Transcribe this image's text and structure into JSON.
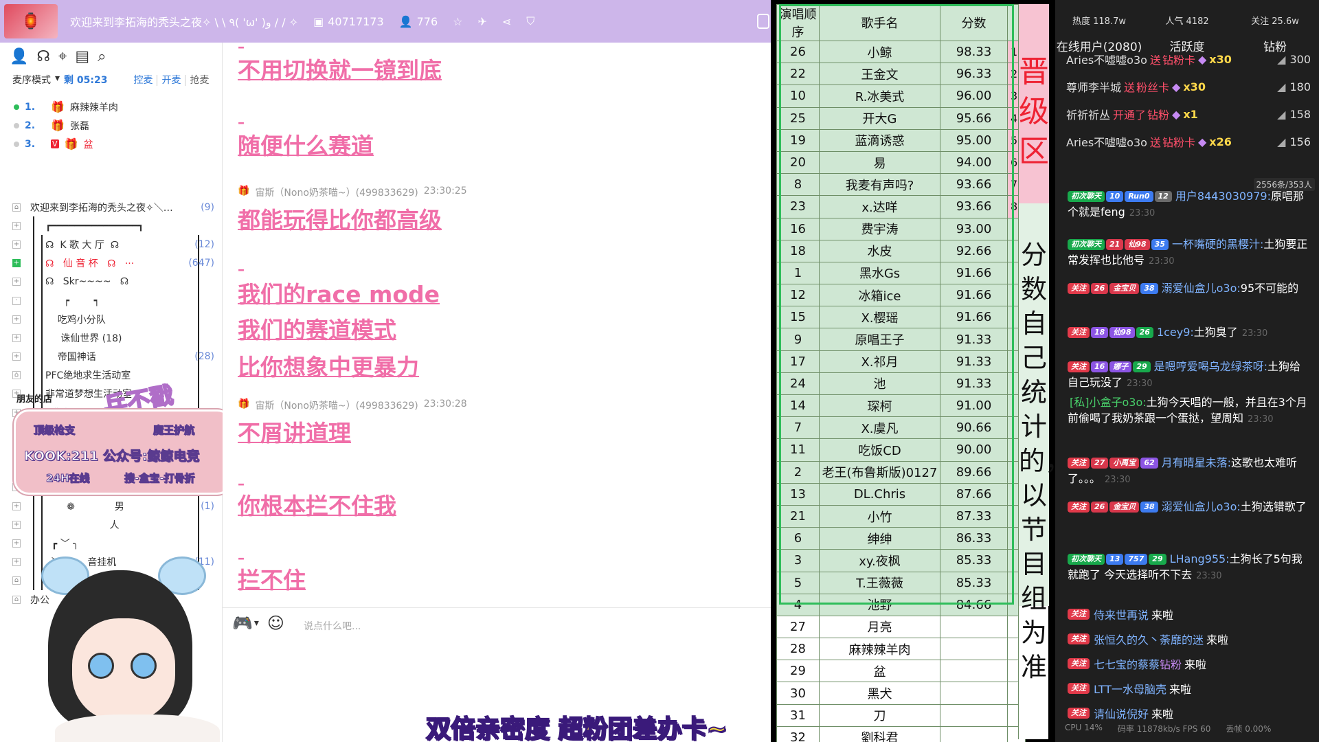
{
  "topbar": {
    "title": "欢迎来到李拓海的秃头之夜✧ \\ \\ ٩( 'ω' )و / / ✧",
    "id": "40717173",
    "online": "776"
  },
  "sidebar": {
    "mic_mode": "麦序模式",
    "remaining": "剩 05:23",
    "actions": [
      "控麦",
      "开麦",
      "抢麦"
    ],
    "queue": [
      {
        "num": "1.",
        "name": "麻辣辣羊肉",
        "red": false,
        "vip": false
      },
      {
        "num": "2.",
        "name": "张磊",
        "red": false,
        "vip": false
      },
      {
        "num": "3.",
        "name": "盆",
        "red": true,
        "vip": true
      }
    ],
    "channels": [
      {
        "label": "欢迎来到李拓海的秃头之夜✧＼…",
        "count": "(9)",
        "pm": "⌂",
        "red": false,
        "bars": 0
      },
      {
        "label": "┏━━━━━━━━━━━━━━━┓",
        "count": "",
        "pm": "+",
        "red": false,
        "bars": 1
      },
      {
        "label": "☊  K 歌 大 厅  ☊",
        "count": "(12)",
        "pm": "+",
        "red": false,
        "bars": 2
      },
      {
        "label": "☊   仙 音 杯   ☊   ···",
        "count": "(647)",
        "pm": "+",
        "red": true,
        "bars": 2
      },
      {
        "label": "☊   Skr~~~~   ☊",
        "count": "",
        "pm": "+",
        "red": false,
        "bars": 2
      },
      {
        "label": "      ┍        ┑",
        "count": "",
        "pm": "·",
        "red": false,
        "bars": 2
      },
      {
        "label": "    吃鸡小分队",
        "count": "",
        "pm": "+",
        "red": false,
        "bars": 2
      },
      {
        "label": "     诛仙世界 (18)",
        "count": "",
        "pm": "+",
        "red": false,
        "bars": 2
      },
      {
        "label": "    帝国神话",
        "count": "(28)",
        "pm": "+",
        "red": false,
        "bars": 2
      },
      {
        "label": "PFC绝地求生活动室",
        "count": "",
        "pm": "⌂",
        "red": false,
        "bars": 2
      },
      {
        "label": "非常道梦想生活动室",
        "count": "",
        "pm": "+",
        "red": false,
        "bars": 2
      },
      {
        "label": "  非常",
        "count": "",
        "pm": "+",
        "red": false,
        "bars": 2
      },
      {
        "label": "",
        "count": "",
        "pm": "+",
        "red": false,
        "bars": 2
      },
      {
        "label": "",
        "count": "",
        "pm": "+",
        "red": false,
        "bars": 2
      },
      {
        "label": "",
        "count": "",
        "pm": "+",
        "red": false,
        "bars": 2
      },
      {
        "label": "",
        "count": "",
        "pm": "+",
        "red": false,
        "bars": 2
      },
      {
        "label": "       ❁             男",
        "count": "(1)",
        "pm": "+",
        "red": false,
        "bars": 2
      },
      {
        "label": "                     人",
        "count": "",
        "pm": "+",
        "red": false,
        "bars": 2
      },
      {
        "label": "  ┏ ﹀ ╮",
        "count": "",
        "pm": "+",
        "red": false,
        "bars": 2
      },
      {
        "label": "  ﹀  ❁    音挂机",
        "count": "(11)",
        "pm": "+",
        "red": false,
        "bars": 2
      },
      {
        "label": "",
        "count": "",
        "pm": "⌂",
        "red": false,
        "bars": 2
      },
      {
        "label": "办公",
        "count": "",
        "pm": "⌂",
        "red": false,
        "bars": 0
      }
    ]
  },
  "ad": {
    "friend_shop": "朋友的店",
    "stamp": "兵不戳",
    "line1_left": "顶级枪支",
    "line1_right": "魔王护航",
    "line2": "KOOK:211  公众号:鲸鲸电竞",
    "line3_left": "24H在线",
    "line3_right": "搜-盒宝-打骨折"
  },
  "chat": {
    "items": [
      {
        "kind": "dash",
        "text": "–"
      },
      {
        "kind": "line",
        "text": "不用切换就一镜到底"
      },
      {
        "kind": "dash",
        "text": "–"
      },
      {
        "kind": "line",
        "text": "随便什么赛道"
      },
      {
        "kind": "head",
        "user": "宙斯（Nono奶茶喵~）(499833629)",
        "time": "23:30:25"
      },
      {
        "kind": "line",
        "text": "都能玩得比你都高级"
      },
      {
        "kind": "dash",
        "text": "–"
      },
      {
        "kind": "line",
        "text": "我们的race mode"
      },
      {
        "kind": "line",
        "text": "我们的赛道模式"
      },
      {
        "kind": "line",
        "text": "比你想象中更暴力"
      },
      {
        "kind": "head",
        "user": "宙斯（Nono奶茶喵~）(499833629)",
        "time": "23:30:28"
      },
      {
        "kind": "line",
        "text": "不屑讲道理"
      },
      {
        "kind": "dash",
        "text": "–"
      },
      {
        "kind": "line",
        "text": "你根本拦不住我"
      },
      {
        "kind": "dash",
        "text": "–"
      },
      {
        "kind": "line",
        "text": "拦不住"
      }
    ],
    "input_placeholder": "说点什么吧..."
  },
  "subtitle": "双倍亲密度 超粉团差办卡~",
  "score_table": {
    "headers": [
      "演唱顺序",
      "歌手名",
      "分数",
      ""
    ],
    "promo_label": "晋级区",
    "note_label": "分数自己统计的，以节目组为准",
    "rows": [
      {
        "order": "26",
        "name": "小鲸",
        "score": "98.33",
        "pos": "1"
      },
      {
        "order": "22",
        "name": "王金文",
        "score": "96.33",
        "pos": "2"
      },
      {
        "order": "10",
        "name": "R.冰美式",
        "score": "96.00",
        "pos": "3"
      },
      {
        "order": "25",
        "name": "开大G",
        "score": "95.66",
        "pos": "4"
      },
      {
        "order": "19",
        "name": "蓝滴诱惑",
        "score": "95.00",
        "pos": "5"
      },
      {
        "order": "20",
        "name": "易",
        "score": "94.00",
        "pos": "6"
      },
      {
        "order": "8",
        "name": "我麦有声吗?",
        "score": "93.66",
        "pos": "7"
      },
      {
        "order": "23",
        "name": "x.达咩",
        "score": "93.66",
        "pos": "8"
      },
      {
        "order": "16",
        "name": "费宇涛",
        "score": "93.00",
        "pos": ""
      },
      {
        "order": "18",
        "name": "水皮",
        "score": "92.66",
        "pos": ""
      },
      {
        "order": "1",
        "name": "黑水Gs",
        "score": "91.66",
        "pos": ""
      },
      {
        "order": "12",
        "name": "冰箱ice",
        "score": "91.66",
        "pos": ""
      },
      {
        "order": "15",
        "name": "X.樱瑶",
        "score": "91.66",
        "pos": ""
      },
      {
        "order": "9",
        "name": "原唱王子",
        "score": "91.33",
        "pos": ""
      },
      {
        "order": "17",
        "name": "X.祁月",
        "score": "91.33",
        "pos": ""
      },
      {
        "order": "24",
        "name": "池",
        "score": "91.33",
        "pos": ""
      },
      {
        "order": "14",
        "name": "琛柯",
        "score": "91.00",
        "pos": ""
      },
      {
        "order": "7",
        "name": "X.虞凡",
        "score": "90.66",
        "pos": ""
      },
      {
        "order": "11",
        "name": "吃饭CD",
        "score": "90.00",
        "pos": ""
      },
      {
        "order": "2",
        "name": "老王(布鲁斯版)0127",
        "score": "89.66",
        "pos": ""
      },
      {
        "order": "13",
        "name": "DL.Chris",
        "score": "87.66",
        "pos": ""
      },
      {
        "order": "21",
        "name": "小竹",
        "score": "87.33",
        "pos": ""
      },
      {
        "order": "6",
        "name": "绅绅",
        "score": "86.33",
        "pos": ""
      },
      {
        "order": "3",
        "name": "xy.夜枫",
        "score": "85.33",
        "pos": ""
      },
      {
        "order": "5",
        "name": "T.王薇薇",
        "score": "85.33",
        "pos": ""
      },
      {
        "order": "4",
        "name": "池野",
        "score": "84.66",
        "pos": ""
      }
    ],
    "rest": [
      {
        "order": "27",
        "name": "月亮"
      },
      {
        "order": "28",
        "name": "麻辣辣羊肉"
      },
      {
        "order": "29",
        "name": "盆"
      },
      {
        "order": "30",
        "name": "黑犬"
      },
      {
        "order": "31",
        "name": "刀"
      },
      {
        "order": "32",
        "name": "劉科君"
      }
    ]
  },
  "live": {
    "stats": [
      "热度 118.7w",
      "人气 4182",
      "关注 25.6w"
    ],
    "tabs": [
      "在线用户(2080)",
      "活跃度",
      "钻粉"
    ],
    "gifts": [
      {
        "user": "Aries不嘘嘘o3o",
        "act": "送",
        "item": "钻粉卡",
        "x": "x30",
        "score": "300"
      },
      {
        "user": "尊师李半城",
        "act": "送",
        "item": "粉丝卡",
        "x": "x30",
        "score": "180"
      },
      {
        "user": "祈祈祈丛",
        "act": "开通了",
        "item": "钻粉",
        "x": "x1",
        "score": "158"
      },
      {
        "user": "Aries不嘘嘘o3o",
        "act": "送",
        "item": "钻粉卡",
        "x": "x26",
        "score": "156"
      }
    ],
    "counter": "2556条/353人",
    "messages": [
      {
        "badges": [
          [
            "初次聊天",
            "b-green"
          ],
          [
            "10",
            "b-blue"
          ],
          [
            "Run0",
            "b-blue"
          ],
          [
            "12",
            "b-level"
          ]
        ],
        "nick": "用户8443030979:",
        "text": "原唱那个就是feng",
        "ts": "23:30"
      },
      {
        "badges": [
          [
            "初次聊天",
            "b-green"
          ],
          [
            "21",
            "b-vip"
          ],
          [
            "仙98",
            "b-vip"
          ],
          [
            "35",
            "b-blue"
          ]
        ],
        "nick": "一杯嘴硬的黑樱汁:",
        "text": "土狗要正常发挥也比他号",
        "ts": "23:30"
      },
      {
        "badges": [
          [
            "关注",
            "b-red"
          ],
          [
            "26",
            "b-vip"
          ],
          [
            "金宝贝",
            "b-vip"
          ],
          [
            "38",
            "b-blue"
          ]
        ],
        "nick": "溺爱仙盒儿o3o:",
        "text": "95不可能的",
        "ts": ""
      },
      {
        "badges": [
          [
            "关注",
            "b-red"
          ],
          [
            "18",
            "b-purple"
          ],
          [
            "仙98",
            "b-purple"
          ],
          [
            "26",
            "b-green"
          ]
        ],
        "nick": "1cey9:",
        "text": "土狗臭了",
        "ts": "23:30"
      },
      {
        "badges": [
          [
            "关注",
            "b-red"
          ],
          [
            "16",
            "b-purple"
          ],
          [
            "娜子",
            "b-purple"
          ],
          [
            "29",
            "b-green"
          ]
        ],
        "nick": "是嗯哼爱喝乌龙绿茶呀:",
        "text": "土狗给自己玩没了",
        "ts": "23:30"
      },
      {
        "badges": [],
        "nick": "[私]小盒子o3o:",
        "text": "土狗今天唱的一般，并且在3个月前偷喝了我奶茶跟一个蛋挞，望周知",
        "ts": "23:30",
        "green": true
      },
      {
        "badges": [
          [
            "关注",
            "b-red"
          ],
          [
            "27",
            "b-vip"
          ],
          [
            "小禹宝",
            "b-vip"
          ],
          [
            "62",
            "b-purple"
          ]
        ],
        "nick": "月有晴星未落:",
        "text": "这歌也太难听了。。。",
        "ts": "23:30"
      },
      {
        "badges": [
          [
            "关注",
            "b-red"
          ],
          [
            "26",
            "b-vip"
          ],
          [
            "金宝贝",
            "b-vip"
          ],
          [
            "38",
            "b-blue"
          ]
        ],
        "nick": "溺爱仙盒儿o3o:",
        "text": "土狗选错歌了",
        "ts": ""
      },
      {
        "badges": [
          [
            "初次聊天",
            "b-green"
          ],
          [
            "13",
            "b-blue"
          ],
          [
            "757",
            "b-blue"
          ],
          [
            "29",
            "b-green"
          ]
        ],
        "nick": "LHang955:",
        "text": "土狗长了5句我就跑了 今天选择听不下去",
        "ts": "23:30"
      }
    ],
    "enters": [
      {
        "nick": "侍来世再说",
        "extra": ""
      },
      {
        "nick": "张恒久的久丶荼靡的迷",
        "extra": ""
      },
      {
        "nick": "七七宝的蔡蔡",
        "extra": "钻粉"
      },
      {
        "nick": "LTT一水母脑壳",
        "extra": ""
      },
      {
        "nick": "请仙说倪好",
        "extra": ""
      }
    ],
    "enter_tag": "关注",
    "enter_come": "来啦",
    "status": [
      "CPU 14%",
      "码率 11878kb/s FPS 60",
      "丢帧 0.00%"
    ]
  }
}
